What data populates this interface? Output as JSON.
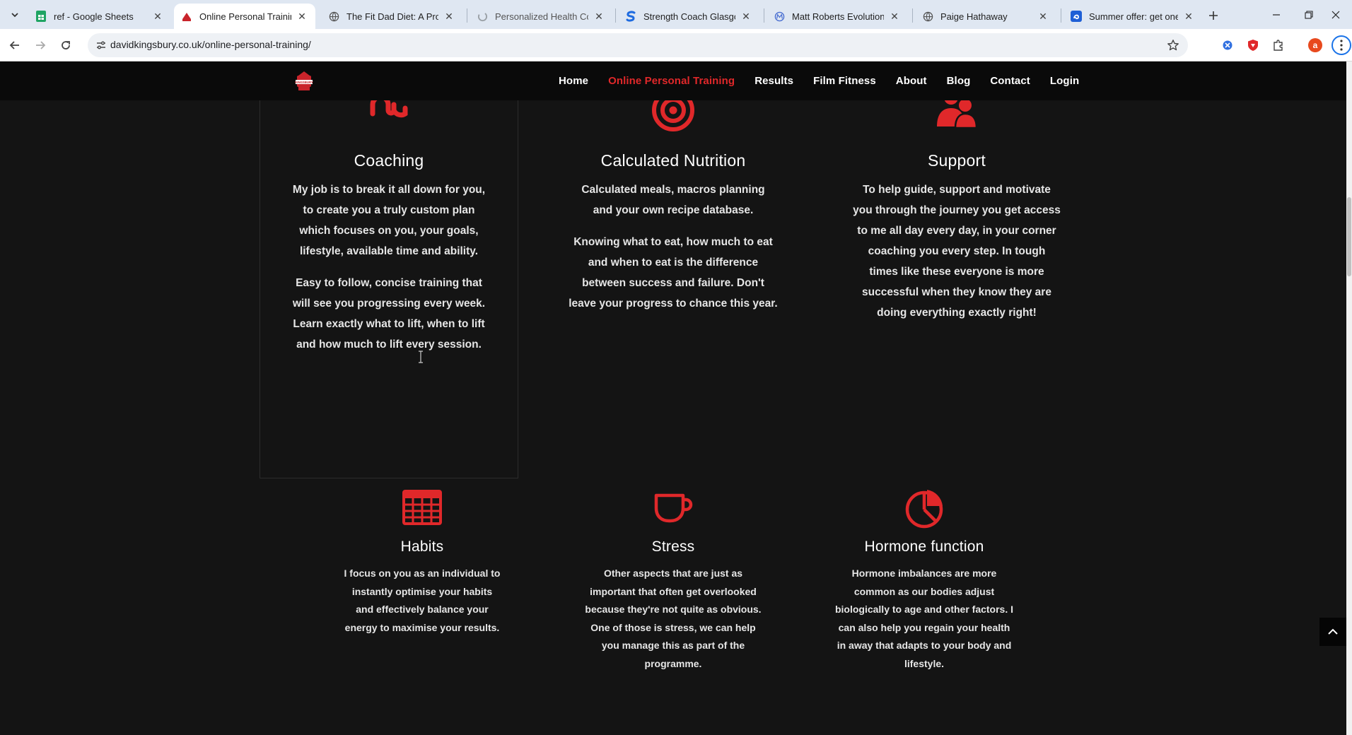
{
  "browser": {
    "tabs": [
      {
        "title": "ref - Google Sheets",
        "active": false
      },
      {
        "title": "Online Personal Training |",
        "active": true
      },
      {
        "title": "The Fit Dad Diet: A Proven",
        "active": false
      },
      {
        "title": "Personalized Health Coach",
        "active": false
      },
      {
        "title": "Strength Coach Glasgow |",
        "active": false
      },
      {
        "title": "Matt Roberts Evolution | T",
        "active": false
      },
      {
        "title": "Paige Hathaway",
        "active": false
      },
      {
        "title": "Summer offer: get one m",
        "active": false
      }
    ],
    "url": "davidkingsbury.co.uk/online-personal-training/",
    "profile_initial": "a",
    "accent": "#e0282a"
  },
  "site": {
    "logo_text": "KINGSBURY",
    "nav": [
      {
        "label": "Home",
        "current": false
      },
      {
        "label": "Online Personal Training",
        "current": true
      },
      {
        "label": "Results",
        "current": false
      },
      {
        "label": "Film Fitness",
        "current": false
      },
      {
        "label": "About",
        "current": false
      },
      {
        "label": "Blog",
        "current": false
      },
      {
        "label": "Contact",
        "current": false
      },
      {
        "label": "Login",
        "current": false
      }
    ]
  },
  "features_row1": [
    {
      "icon": "stumbleupon-icon",
      "title": "Coaching",
      "paragraphs": [
        "My job is to break it all down for you, to create you a truly custom plan which focuses on you, your goals, lifestyle, available time and ability.",
        "Easy to follow, concise training that will see you progressing every week. Learn exactly what to lift, when to lift and how much to lift every session."
      ]
    },
    {
      "icon": "target-icon",
      "title": "Calculated Nutrition",
      "paragraphs": [
        "Calculated meals, macros planning and your own recipe database.",
        "Knowing what to eat, how much to eat and when to eat is the difference between success and failure. Don't leave your progress to chance this year."
      ]
    },
    {
      "icon": "users-icon",
      "title": "Support",
      "paragraphs": [
        "To help guide, support and motivate you through the journey you get access to me all day every day, in your corner coaching you every step. In tough times like these everyone is more successful when they know they are doing everything exactly right!"
      ]
    }
  ],
  "features_row2": [
    {
      "icon": "table-grid-icon",
      "title": "Habits",
      "text": "I focus on you as an individual to instantly optimise your habits and effectively balance your energy to maximise your results."
    },
    {
      "icon": "coffee-cup-icon",
      "title": "Stress",
      "text": "Other aspects that are just as important that often get overlooked because they're not quite as obvious. One of those is stress, we can help you manage this as part of the programme."
    },
    {
      "icon": "pie-chart-icon",
      "title": "Hormone function",
      "text": "Hormone imbalances are more common as our bodies adjust biologically to age and other factors. I can also help you regain your health in away that adapts to your body and lifestyle."
    }
  ]
}
